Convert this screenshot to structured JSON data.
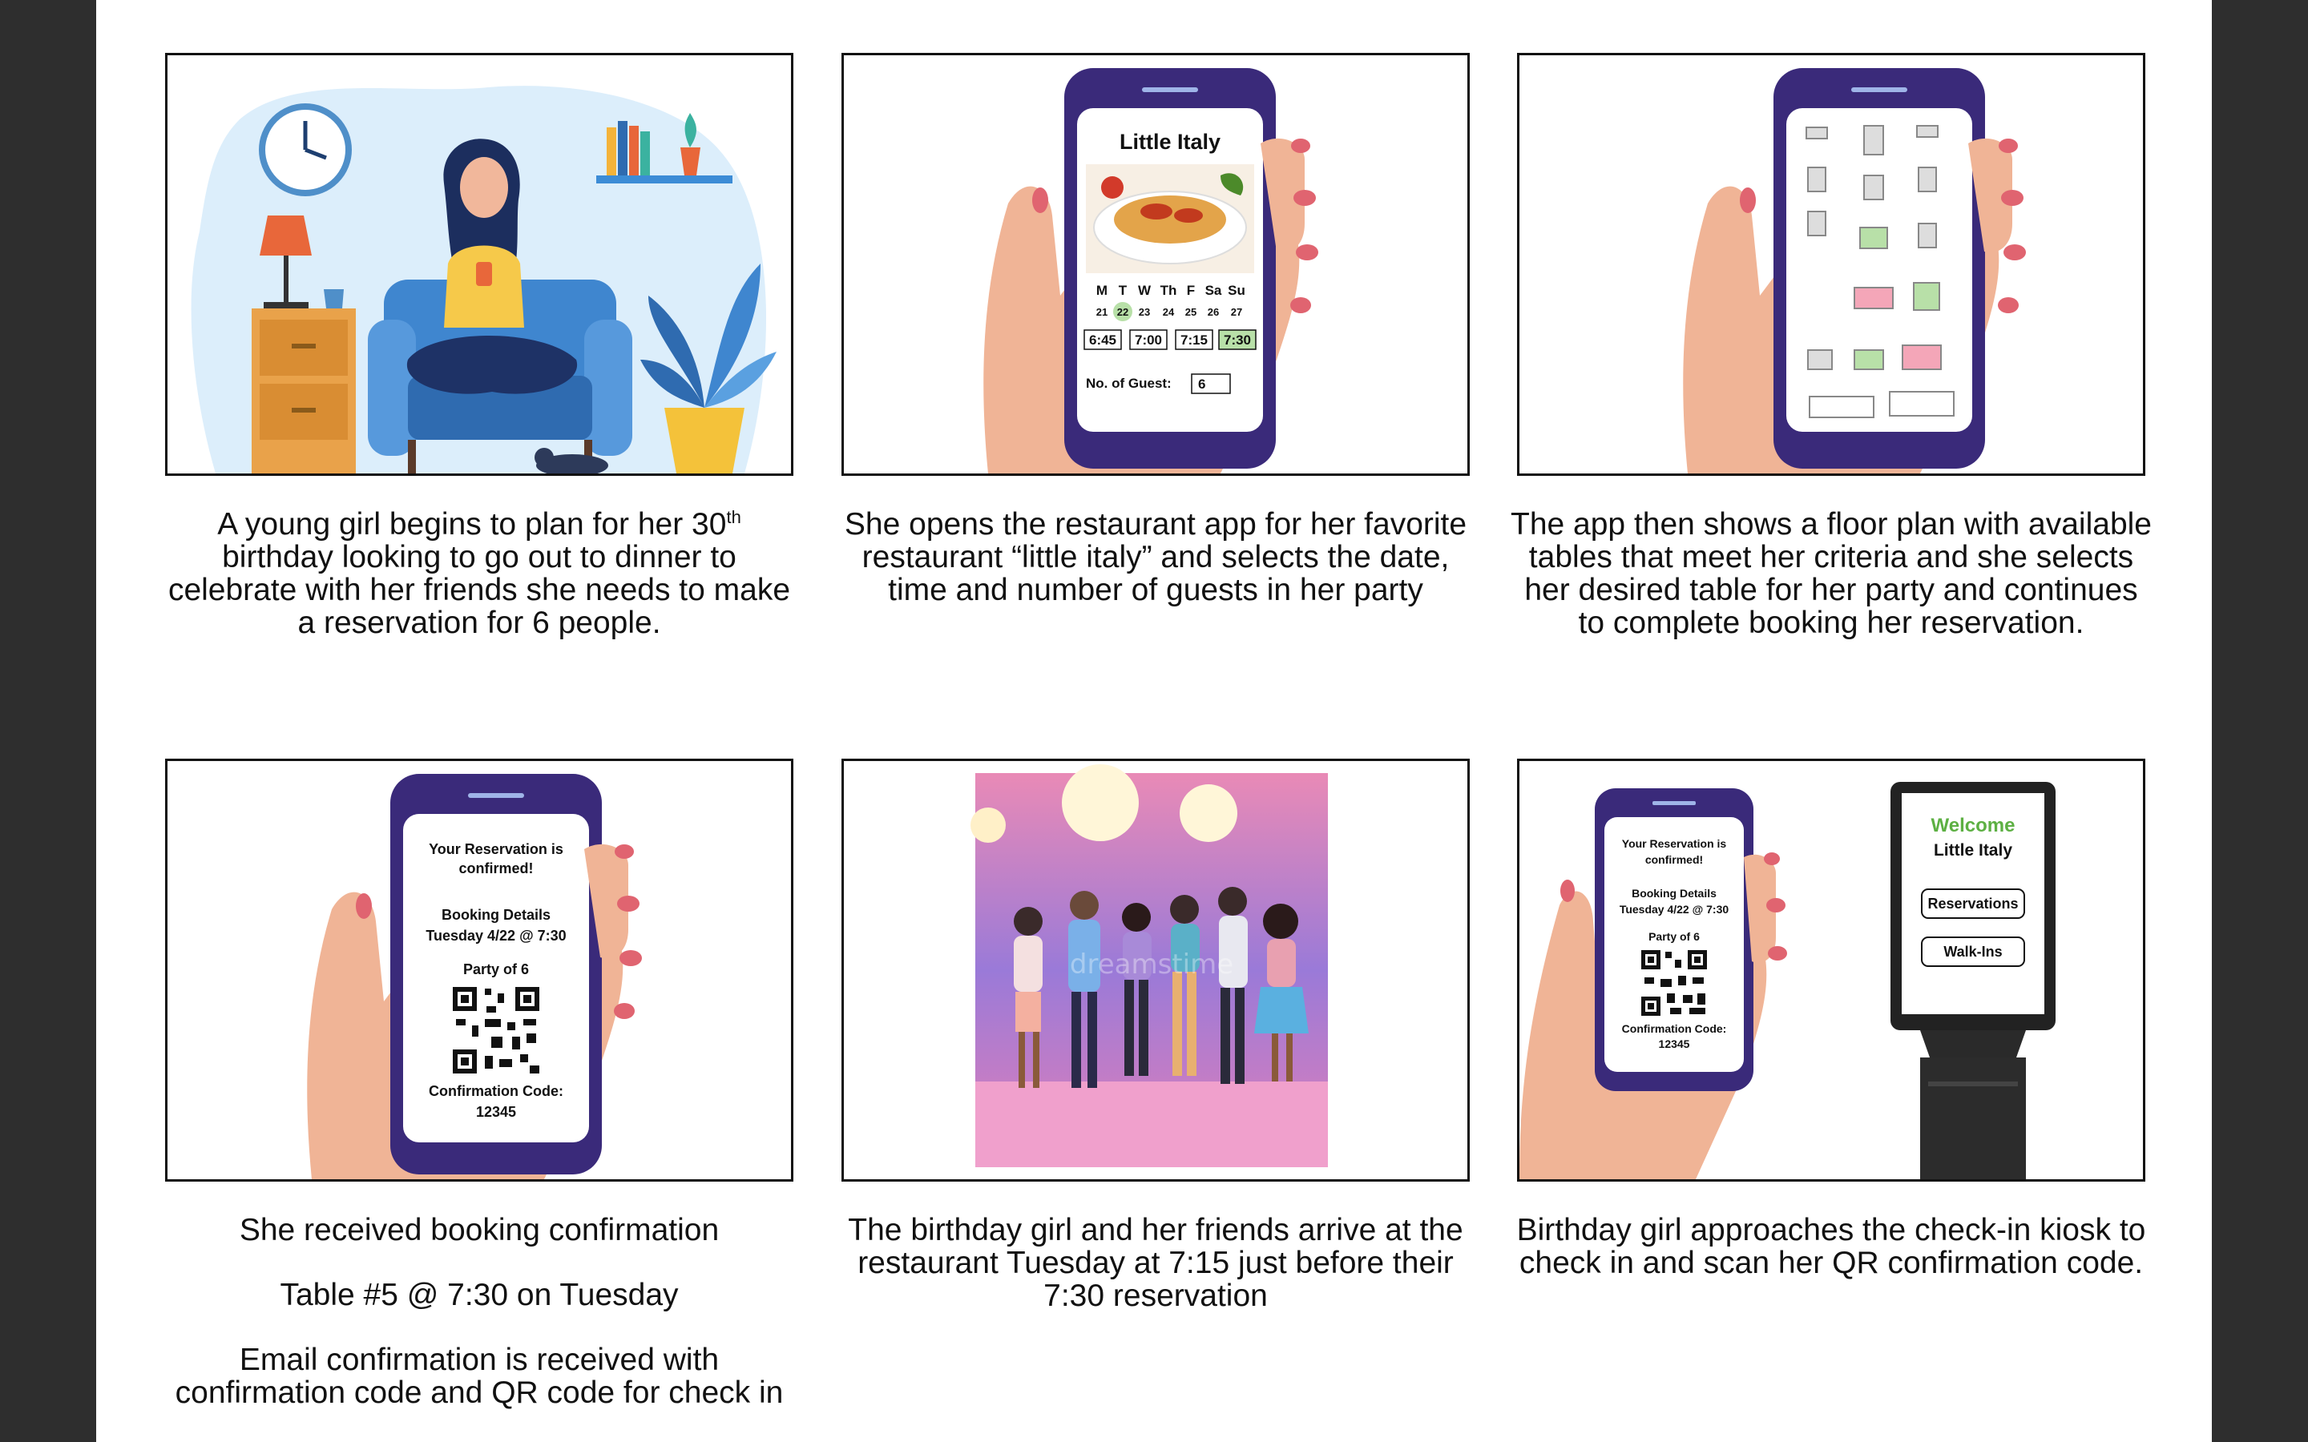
{
  "captions": {
    "p1": {
      "pre": "A young girl begins to plan for her 30",
      "sup": "th",
      "post": " birthday looking to go out to dinner to celebrate with her friends she needs to make a reservation for 6 people."
    },
    "p2": "She opens the restaurant app for her favorite restaurant “little italy” and selects the date, time and number of guests in her party",
    "p3": "The app then shows a floor plan with available tables that meet her criteria and she selects her desired table for her party and continues to complete booking her reservation.",
    "p4": {
      "line1": "She received booking confirmation",
      "line2": "Table #5 @ 7:30 on Tuesday",
      "line3": "Email confirmation is received with confirmation code and QR code for check in"
    },
    "p5": "The birthday girl and her friends arrive at the restaurant Tuesday at 7:15 just before their 7:30 reservation",
    "p6": "Birthday girl approaches the check-in kiosk to check in and scan her QR confirmation code."
  },
  "app": {
    "restaurant_name": "Little Italy",
    "days": [
      "M",
      "T",
      "W",
      "Th",
      "F",
      "Sa",
      "Su"
    ],
    "dates": [
      "21",
      "22",
      "23",
      "24",
      "25",
      "26",
      "27"
    ],
    "selected_date": "22",
    "times": [
      "6:45",
      "7:00",
      "7:15",
      "7:30"
    ],
    "selected_time": "7:30",
    "guests_label": "No. of Guest:",
    "guests_value": "6"
  },
  "confirmation": {
    "line1": "Your Reservation is",
    "line2": "confirmed!",
    "details_title": "Booking Details",
    "details_value": "Tuesday 4/22 @ 7:30",
    "party": "Party of 6",
    "code_label": "Confirmation Code:",
    "code_value": "12345"
  },
  "kiosk": {
    "welcome": "Welcome",
    "name": "Little Italy",
    "btn_reservations": "Reservations",
    "btn_walkins": "Walk-Ins"
  },
  "watermark": "dreamstime",
  "colors": {
    "phone": "#3a2a7a",
    "skin": "#f0b496",
    "nail": "#e06470",
    "green_sel": "#b8e0a8",
    "kiosk_green": "#5db043"
  }
}
